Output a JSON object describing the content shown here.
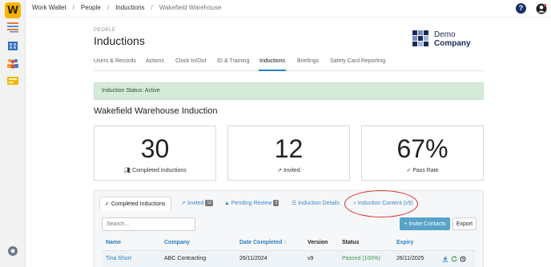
{
  "app": {
    "logo_letter": "W"
  },
  "breadcrumbs": [
    "Work Wallet",
    "People",
    "Inductions",
    "Wakefield Warehouse"
  ],
  "header": {
    "eyebrow": "PEOPLE",
    "title": "Inductions",
    "company_line1": "Demo",
    "company_line2": "Company"
  },
  "tabs": [
    "Users & Records",
    "Actions",
    "Clock In/Out",
    "ID & Training",
    "Inductions",
    "Briefings",
    "Safety Card Reporting"
  ],
  "active_tab": "Inductions",
  "status_text": "Induction Status: Active",
  "section_title": "Wakefield Warehouse Induction",
  "stats": [
    {
      "value": "30",
      "label": "Completed Inductions",
      "icon": "users-icon"
    },
    {
      "value": "12",
      "label": "Invited",
      "icon": "send-icon"
    },
    {
      "value": "67%",
      "label": "Pass Rate",
      "icon": "check-icon"
    }
  ],
  "panel_tabs": [
    {
      "label": "Completed Inductions",
      "prefix": "✓",
      "badge": ""
    },
    {
      "label": "Invited",
      "prefix": "",
      "badge": "12"
    },
    {
      "label": "Pending Review",
      "prefix": "",
      "badge": "3"
    },
    {
      "label": "Induction Details",
      "prefix": "",
      "badge": ""
    },
    {
      "label": "Induction Content (v9)",
      "prefix": "",
      "badge": ""
    }
  ],
  "search_placeholder": "Search...",
  "buttons": {
    "invite": "+ Invite Contacts",
    "export": "Export"
  },
  "table": {
    "columns": [
      "Name",
      "Company",
      "Date Completed ↑",
      "Version",
      "Status",
      "Expiry"
    ],
    "rows": [
      [
        "Tina Short",
        "ABC Contracting",
        "26/11/2024",
        "v9",
        "Passed (100%)",
        "26/11/2025"
      ]
    ]
  },
  "colors": {
    "accent": "#2d7fc1",
    "status_bg": "#d6ead9",
    "passed": "#3a9a49",
    "highlight_circle": "#d9302b",
    "primary_button": "#58a3c8"
  }
}
